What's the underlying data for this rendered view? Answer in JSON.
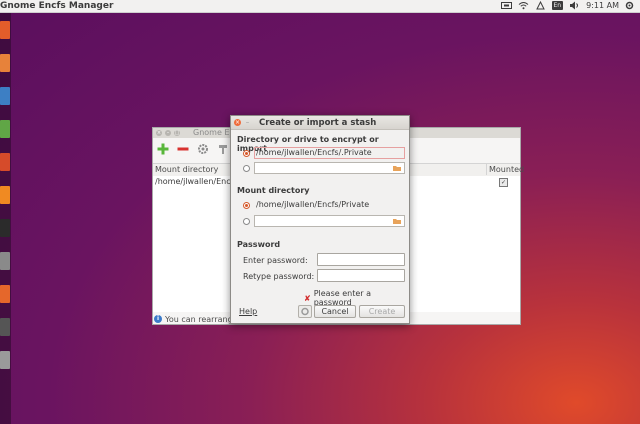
{
  "top_panel": {
    "app_title": "Gnome Encfs Manager",
    "keyboard_indicator": "En",
    "time": "9:11 AM"
  },
  "launcher": {
    "app_colors": [
      "#e35d2a",
      "#e7823a",
      "#3d7fc4",
      "#60a646",
      "#d64b2a",
      "#f08a22",
      "#2b2b2b",
      "#8a8a8a",
      "#e5672b",
      "#555555",
      "#9a9a9a"
    ]
  },
  "manager": {
    "title": "Gnome Encfs",
    "column_mount": "Mount directory",
    "column_mounted": "Mounted",
    "row_path": "/home/jlwallen/Encfs",
    "status": "You can rearrange"
  },
  "dialog": {
    "title": "Create or import a stash",
    "section_stash": "Directory or drive to encrypt or import",
    "stash_path": "/home/jlwallen/Encfs/.Private",
    "section_mount": "Mount directory",
    "mount_path": "/home/jlwallen/Encfs/Private",
    "section_password": "Password",
    "enter_password_label": "Enter password:",
    "retype_password_label": "Retype password:",
    "error_text": "Please enter a password",
    "help": "Help",
    "cancel": "Cancel",
    "create": "Create"
  },
  "colors": {
    "accent": "#d65a2b",
    "error": "#d22b2b",
    "invalid_field": "#fbe1e1"
  }
}
